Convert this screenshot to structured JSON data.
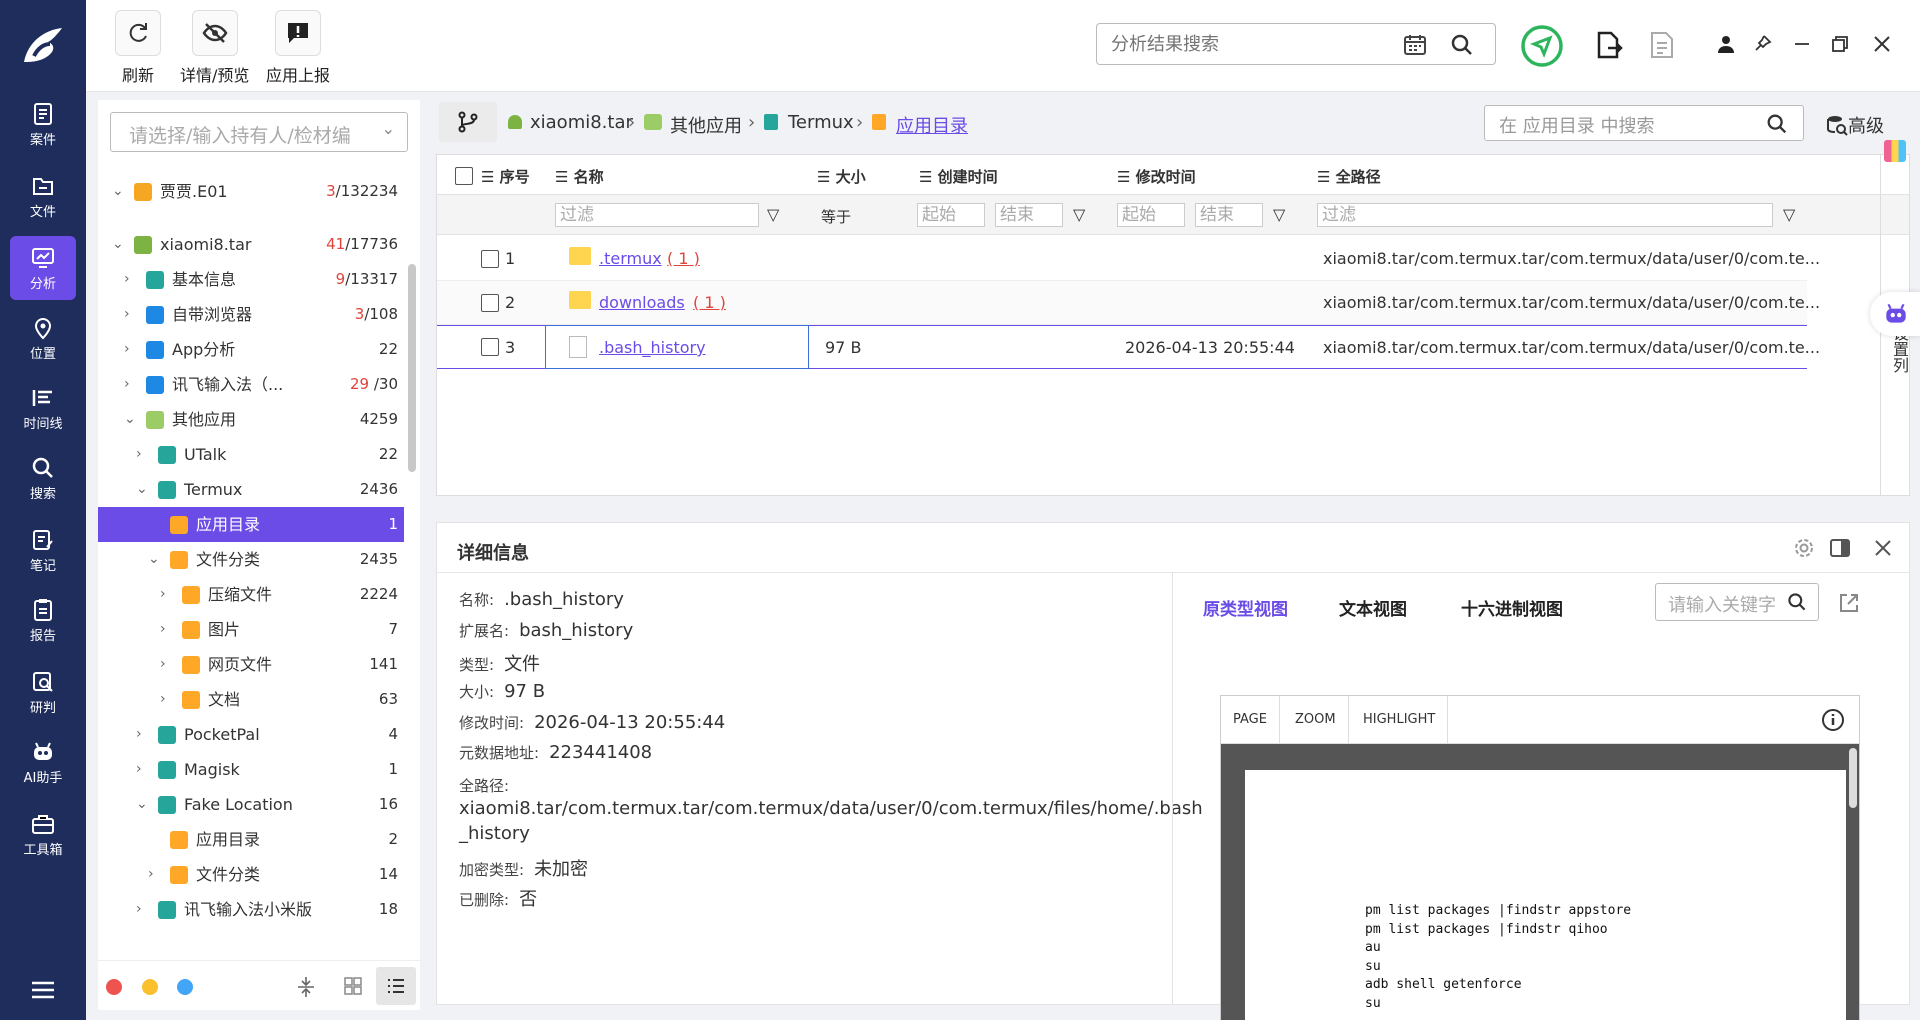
{
  "rail": {
    "items": [
      "案件",
      "文件",
      "分析",
      "位置",
      "时间线",
      "搜索",
      "笔记",
      "报告",
      "研判",
      "AI助手",
      "工具箱"
    ],
    "active_index": 2
  },
  "toolbar": {
    "refresh_label": "刷新",
    "detail_label": "详情/预览",
    "report_label": "应用上报",
    "search_placeholder": "分析结果搜索"
  },
  "sidebar": {
    "select_placeholder": "请选择/输入持有人/检材编",
    "tree": [
      {
        "label": "贾贾.E01",
        "count_red": "3",
        "count": "/132234"
      },
      {
        "label": "xiaomi8.tar",
        "count_red": "41",
        "count": "/17736"
      },
      {
        "label": "基本信息",
        "count_red": "9",
        "count": "/13317"
      },
      {
        "label": "自带浏览器",
        "count_red": "3",
        "count": "/108"
      },
      {
        "label": "App分析",
        "count_red": "",
        "count": "22"
      },
      {
        "label": "讯飞输入法（...",
        "count_red": "29",
        "count": " /30"
      },
      {
        "label": "其他应用",
        "count_red": "",
        "count": "4259"
      },
      {
        "label": "UTalk",
        "count_red": "",
        "count": "22"
      },
      {
        "label": "Termux",
        "count_red": "",
        "count": "2436"
      },
      {
        "label": "应用目录",
        "count_red": "",
        "count": "1"
      },
      {
        "label": "文件分类",
        "count_red": "",
        "count": "2435"
      },
      {
        "label": "压缩文件",
        "count_red": "",
        "count": "2224"
      },
      {
        "label": "图片",
        "count_red": "",
        "count": "7"
      },
      {
        "label": "网页文件",
        "count_red": "",
        "count": "141"
      },
      {
        "label": "文档",
        "count_red": "",
        "count": "63"
      },
      {
        "label": "PocketPal",
        "count_red": "",
        "count": "4"
      },
      {
        "label": "Magisk",
        "count_red": "",
        "count": "1"
      },
      {
        "label": "Fake Location",
        "count_red": "",
        "count": "16"
      },
      {
        "label": "应用目录",
        "count_red": "",
        "count": "2"
      },
      {
        "label": "文件分类",
        "count_red": "",
        "count": "14"
      },
      {
        "label": "讯飞输入法小米版",
        "count_red": "",
        "count": "18"
      }
    ]
  },
  "breadcrumb": {
    "items": [
      "xiaomi8.tar",
      "其他应用",
      "Termux",
      "应用目录"
    ],
    "search_placeholder": "在 应用目录 中搜索",
    "advanced": "高级"
  },
  "grid": {
    "headers": [
      "序号",
      "名称",
      "大小",
      "创建时间",
      "修改时间",
      "全路径"
    ],
    "filter": {
      "placeholder": "过滤",
      "equals": "等于",
      "start": "起始",
      "end": "结束"
    },
    "rows": [
      {
        "no": "1",
        "name": ".termux",
        "badge": "( 1 )",
        "size": "",
        "mtime": "",
        "path": "xiaomi8.tar/com.termux.tar/com.termux/data/user/0/com.te..."
      },
      {
        "no": "2",
        "name": "downloads",
        "badge": "( 1 )",
        "size": "",
        "mtime": "",
        "path": "xiaomi8.tar/com.termux.tar/com.termux/data/user/0/com.te..."
      },
      {
        "no": "3",
        "name": ".bash_history",
        "badge": "",
        "size": "97 B",
        "mtime": "2026-04-13 20:55:44",
        "path": "xiaomi8.tar/com.termux.tar/com.termux/data/user/0/com.te..."
      }
    ],
    "side_label": "设置列"
  },
  "detail": {
    "title": "详细信息",
    "fields": {
      "name_k": "名称:",
      "name_v": ".bash_history",
      "ext_k": "扩展名:",
      "ext_v": "bash_history",
      "type_k": "类型:",
      "type_v": "文件",
      "size_k": "大小:",
      "size_v": "97 B",
      "mtime_k": "修改时间:",
      "mtime_v": "2026-04-13 20:55:44",
      "meta_k": "元数据地址:",
      "meta_v": "223441408",
      "path_k": "全路径:",
      "path_v1": "xiaomi8.tar/com.termux.tar/com.termux/data/user/0/com.termux/files/home/.bash",
      "path_v2": "_history",
      "enc_k": "加密类型:",
      "enc_v": "未加密",
      "del_k": "已删除:",
      "del_v": "否"
    },
    "viewer": {
      "tabs": [
        "原类型视图",
        "文本视图",
        "十六进制视图"
      ],
      "keyword_placeholder": "请输入关键字",
      "pdf_buttons": [
        "PAGE",
        "ZOOM",
        "HIGHLIGHT"
      ],
      "content": "pm list packages |findstr appstore\npm list packages |findstr qihoo\nau\nsu\nadb shell getenforce\nsu"
    }
  },
  "colors": {
    "accent": "#6b4ce6",
    "rail": "#1f2d5c",
    "red": "#e0443a"
  }
}
